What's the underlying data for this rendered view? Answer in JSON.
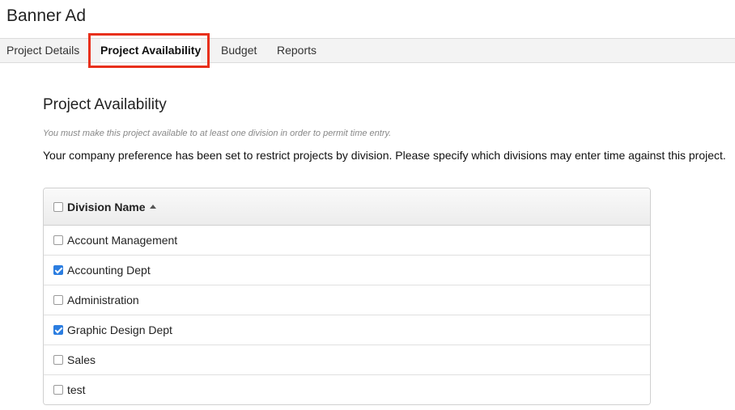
{
  "page": {
    "title": "Banner Ad"
  },
  "tabs": [
    {
      "label": "Project Details"
    },
    {
      "label": "Project Availability",
      "active": true
    },
    {
      "label": "Budget"
    },
    {
      "label": "Reports"
    }
  ],
  "section": {
    "title": "Project Availability",
    "note": "You must make this project available to at least one division in order to permit time entry.",
    "description": "Your company preference has been set to restrict projects by division. Please specify which divisions may enter time against this project."
  },
  "grid": {
    "header": {
      "label": "Division Name",
      "sort_icon": "sort-asc-icon",
      "checked": false
    },
    "rows": [
      {
        "label": "Account Management",
        "checked": false
      },
      {
        "label": "Accounting Dept",
        "checked": true
      },
      {
        "label": "Administration",
        "checked": false
      },
      {
        "label": "Graphic Design Dept",
        "checked": true
      },
      {
        "label": "Sales",
        "checked": false
      },
      {
        "label": "test",
        "checked": false
      }
    ]
  },
  "colors": {
    "highlight": "#e8301c",
    "checkbox_checked": "#2b7de0"
  }
}
